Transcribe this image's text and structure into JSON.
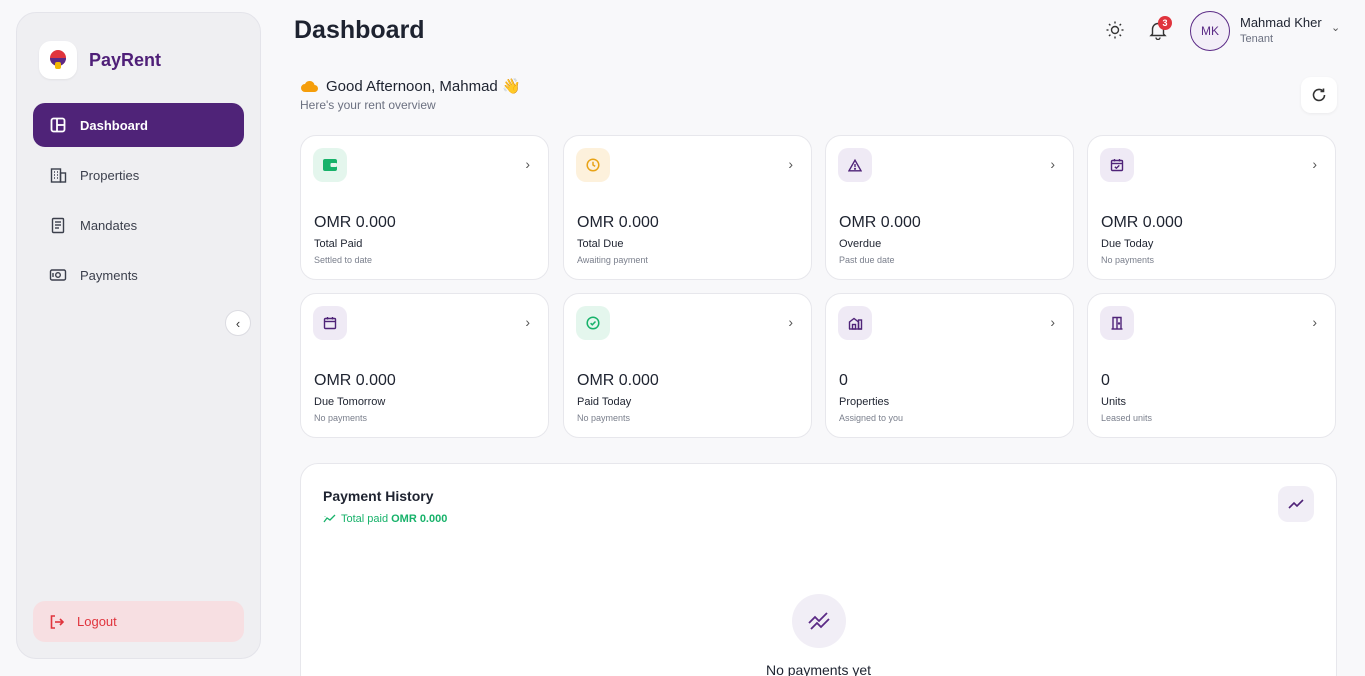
{
  "brand": {
    "name": "PayRent"
  },
  "sidebar": {
    "items": [
      {
        "label": "Dashboard",
        "icon": "layout-icon",
        "active": true
      },
      {
        "label": "Properties",
        "icon": "building-icon"
      },
      {
        "label": "Mandates",
        "icon": "document-icon"
      },
      {
        "label": "Payments",
        "icon": "cash-icon"
      }
    ],
    "logout_label": "Logout"
  },
  "header": {
    "title": "Dashboard",
    "notification_count": "3",
    "user": {
      "initials": "MK",
      "name": "Mahmad Kher",
      "role": "Tenant"
    }
  },
  "greeting": {
    "text": "Good Afternoon, Mahmad 👋",
    "subtitle": "Here's your rent overview"
  },
  "cards": [
    {
      "value": "OMR 0.000",
      "label": "Total Paid",
      "sub": "Settled to date",
      "icon": "wallet-icon",
      "color": "#17b26a"
    },
    {
      "value": "OMR 0.000",
      "label": "Total Due",
      "sub": "Awaiting payment",
      "icon": "clock-icon",
      "color": "#e8a317"
    },
    {
      "value": "OMR 0.000",
      "label": "Overdue",
      "sub": "Past due date",
      "icon": "warning-icon",
      "color": "#5b2a86"
    },
    {
      "value": "OMR 0.000",
      "label": "Due Today",
      "sub": "No payments",
      "icon": "calendar-check-icon",
      "color": "#5b2a86"
    },
    {
      "value": "OMR 0.000",
      "label": "Due Tomorrow",
      "sub": "No payments",
      "icon": "calendar-icon",
      "color": "#5b2a86"
    },
    {
      "value": "OMR 0.000",
      "label": "Paid Today",
      "sub": "No payments",
      "icon": "check-circle-icon",
      "color": "#17b26a"
    },
    {
      "value": "0",
      "label": "Properties",
      "sub": "Assigned to you",
      "icon": "property-icon",
      "color": "#5b2a86"
    },
    {
      "value": "0",
      "label": "Units",
      "sub": "Leased units",
      "icon": "door-icon",
      "color": "#5b2a86"
    }
  ],
  "history": {
    "title": "Payment History",
    "total_label": "Total paid",
    "total_value": "OMR 0.000",
    "empty_text": "No payments yet"
  },
  "colors": {
    "primary": "#4f2378",
    "success": "#17b26a",
    "danger": "#e0343d",
    "warning": "#e8a317"
  }
}
